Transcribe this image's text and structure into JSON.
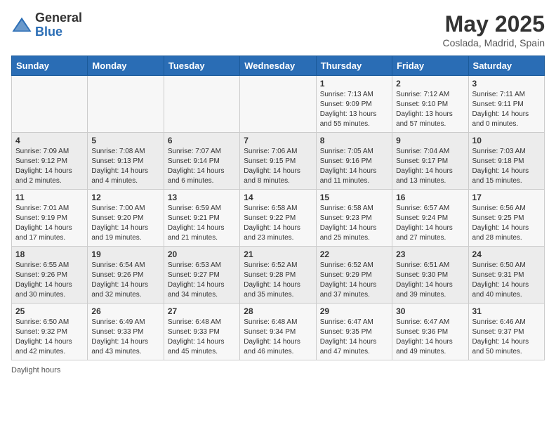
{
  "header": {
    "logo_general": "General",
    "logo_blue": "Blue",
    "month_title": "May 2025",
    "subtitle": "Coslada, Madrid, Spain"
  },
  "days_of_week": [
    "Sunday",
    "Monday",
    "Tuesday",
    "Wednesday",
    "Thursday",
    "Friday",
    "Saturday"
  ],
  "weeks": [
    [
      {
        "day": "",
        "info": ""
      },
      {
        "day": "",
        "info": ""
      },
      {
        "day": "",
        "info": ""
      },
      {
        "day": "",
        "info": ""
      },
      {
        "day": "1",
        "info": "Sunrise: 7:13 AM\nSunset: 9:09 PM\nDaylight: 13 hours and 55 minutes."
      },
      {
        "day": "2",
        "info": "Sunrise: 7:12 AM\nSunset: 9:10 PM\nDaylight: 13 hours and 57 minutes."
      },
      {
        "day": "3",
        "info": "Sunrise: 7:11 AM\nSunset: 9:11 PM\nDaylight: 14 hours and 0 minutes."
      }
    ],
    [
      {
        "day": "4",
        "info": "Sunrise: 7:09 AM\nSunset: 9:12 PM\nDaylight: 14 hours and 2 minutes."
      },
      {
        "day": "5",
        "info": "Sunrise: 7:08 AM\nSunset: 9:13 PM\nDaylight: 14 hours and 4 minutes."
      },
      {
        "day": "6",
        "info": "Sunrise: 7:07 AM\nSunset: 9:14 PM\nDaylight: 14 hours and 6 minutes."
      },
      {
        "day": "7",
        "info": "Sunrise: 7:06 AM\nSunset: 9:15 PM\nDaylight: 14 hours and 8 minutes."
      },
      {
        "day": "8",
        "info": "Sunrise: 7:05 AM\nSunset: 9:16 PM\nDaylight: 14 hours and 11 minutes."
      },
      {
        "day": "9",
        "info": "Sunrise: 7:04 AM\nSunset: 9:17 PM\nDaylight: 14 hours and 13 minutes."
      },
      {
        "day": "10",
        "info": "Sunrise: 7:03 AM\nSunset: 9:18 PM\nDaylight: 14 hours and 15 minutes."
      }
    ],
    [
      {
        "day": "11",
        "info": "Sunrise: 7:01 AM\nSunset: 9:19 PM\nDaylight: 14 hours and 17 minutes."
      },
      {
        "day": "12",
        "info": "Sunrise: 7:00 AM\nSunset: 9:20 PM\nDaylight: 14 hours and 19 minutes."
      },
      {
        "day": "13",
        "info": "Sunrise: 6:59 AM\nSunset: 9:21 PM\nDaylight: 14 hours and 21 minutes."
      },
      {
        "day": "14",
        "info": "Sunrise: 6:58 AM\nSunset: 9:22 PM\nDaylight: 14 hours and 23 minutes."
      },
      {
        "day": "15",
        "info": "Sunrise: 6:58 AM\nSunset: 9:23 PM\nDaylight: 14 hours and 25 minutes."
      },
      {
        "day": "16",
        "info": "Sunrise: 6:57 AM\nSunset: 9:24 PM\nDaylight: 14 hours and 27 minutes."
      },
      {
        "day": "17",
        "info": "Sunrise: 6:56 AM\nSunset: 9:25 PM\nDaylight: 14 hours and 28 minutes."
      }
    ],
    [
      {
        "day": "18",
        "info": "Sunrise: 6:55 AM\nSunset: 9:26 PM\nDaylight: 14 hours and 30 minutes."
      },
      {
        "day": "19",
        "info": "Sunrise: 6:54 AM\nSunset: 9:26 PM\nDaylight: 14 hours and 32 minutes."
      },
      {
        "day": "20",
        "info": "Sunrise: 6:53 AM\nSunset: 9:27 PM\nDaylight: 14 hours and 34 minutes."
      },
      {
        "day": "21",
        "info": "Sunrise: 6:52 AM\nSunset: 9:28 PM\nDaylight: 14 hours and 35 minutes."
      },
      {
        "day": "22",
        "info": "Sunrise: 6:52 AM\nSunset: 9:29 PM\nDaylight: 14 hours and 37 minutes."
      },
      {
        "day": "23",
        "info": "Sunrise: 6:51 AM\nSunset: 9:30 PM\nDaylight: 14 hours and 39 minutes."
      },
      {
        "day": "24",
        "info": "Sunrise: 6:50 AM\nSunset: 9:31 PM\nDaylight: 14 hours and 40 minutes."
      }
    ],
    [
      {
        "day": "25",
        "info": "Sunrise: 6:50 AM\nSunset: 9:32 PM\nDaylight: 14 hours and 42 minutes."
      },
      {
        "day": "26",
        "info": "Sunrise: 6:49 AM\nSunset: 9:33 PM\nDaylight: 14 hours and 43 minutes."
      },
      {
        "day": "27",
        "info": "Sunrise: 6:48 AM\nSunset: 9:33 PM\nDaylight: 14 hours and 45 minutes."
      },
      {
        "day": "28",
        "info": "Sunrise: 6:48 AM\nSunset: 9:34 PM\nDaylight: 14 hours and 46 minutes."
      },
      {
        "day": "29",
        "info": "Sunrise: 6:47 AM\nSunset: 9:35 PM\nDaylight: 14 hours and 47 minutes."
      },
      {
        "day": "30",
        "info": "Sunrise: 6:47 AM\nSunset: 9:36 PM\nDaylight: 14 hours and 49 minutes."
      },
      {
        "day": "31",
        "info": "Sunrise: 6:46 AM\nSunset: 9:37 PM\nDaylight: 14 hours and 50 minutes."
      }
    ]
  ],
  "footer": {
    "daylight_hours": "Daylight hours"
  }
}
